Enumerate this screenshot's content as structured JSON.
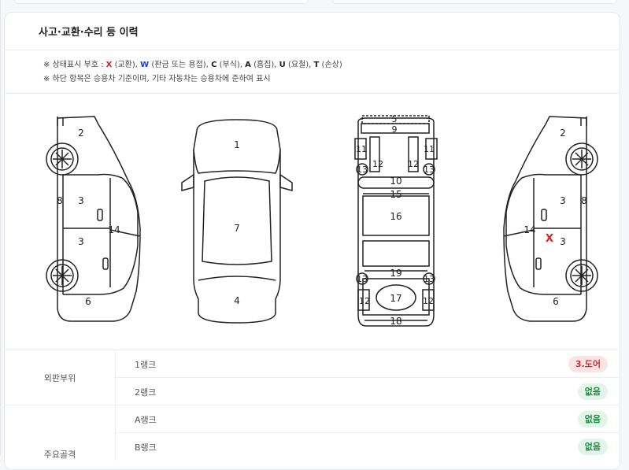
{
  "section": {
    "title": "사고·교환·수리 등 이력",
    "legend_prefix": "※ 상태표시 부호 : ",
    "legend_items": [
      {
        "code": "X",
        "desc": " (교환), "
      },
      {
        "code": "W",
        "desc": " (판금 또는 용접), "
      },
      {
        "code": "C",
        "desc": " (부식), "
      },
      {
        "code": "A",
        "desc": " (흠집), "
      },
      {
        "code": "U",
        "desc": " (요철), "
      },
      {
        "code": "T",
        "desc": " (손상)"
      }
    ],
    "note": "※ 하단 항목은 승용차 기준이며, 기타 자동차는 승용차에 준하여 표시"
  },
  "diagram": {
    "left_side": {
      "n2": "2",
      "n8": "8",
      "n3a": "3",
      "n3b": "3",
      "n14": "14",
      "n6": "6"
    },
    "top_view": {
      "n1": "1",
      "n7": "7",
      "n4": "4"
    },
    "frame": {
      "n5": "5",
      "n9": "9",
      "n11a": "11",
      "n11b": "11",
      "n12a": "12",
      "n12b": "12",
      "n13a": "13",
      "n13b": "13",
      "n10": "10",
      "n15": "15",
      "n16": "16",
      "n13c": "13",
      "n13d": "13",
      "n19": "19",
      "n12c": "12",
      "n17": "17",
      "n12d": "12",
      "n18": "18"
    },
    "right_side": {
      "n2": "2",
      "n3a": "3",
      "n8": "8",
      "n14": "14",
      "x_mark": "X",
      "n3b": "3",
      "n6": "6"
    }
  },
  "table": {
    "groups": [
      {
        "category": "외판부위",
        "rows": [
          {
            "rank": "1랭크",
            "status": "3.도어",
            "status_type": "bad"
          },
          {
            "rank": "2랭크",
            "status": "없음",
            "status_type": "ok"
          }
        ]
      },
      {
        "category": "주요골격",
        "rows": [
          {
            "rank": "A랭크",
            "status": "없음",
            "status_type": "ok"
          },
          {
            "rank": "B랭크",
            "status": "없음",
            "status_type": "ok"
          }
        ]
      }
    ]
  }
}
